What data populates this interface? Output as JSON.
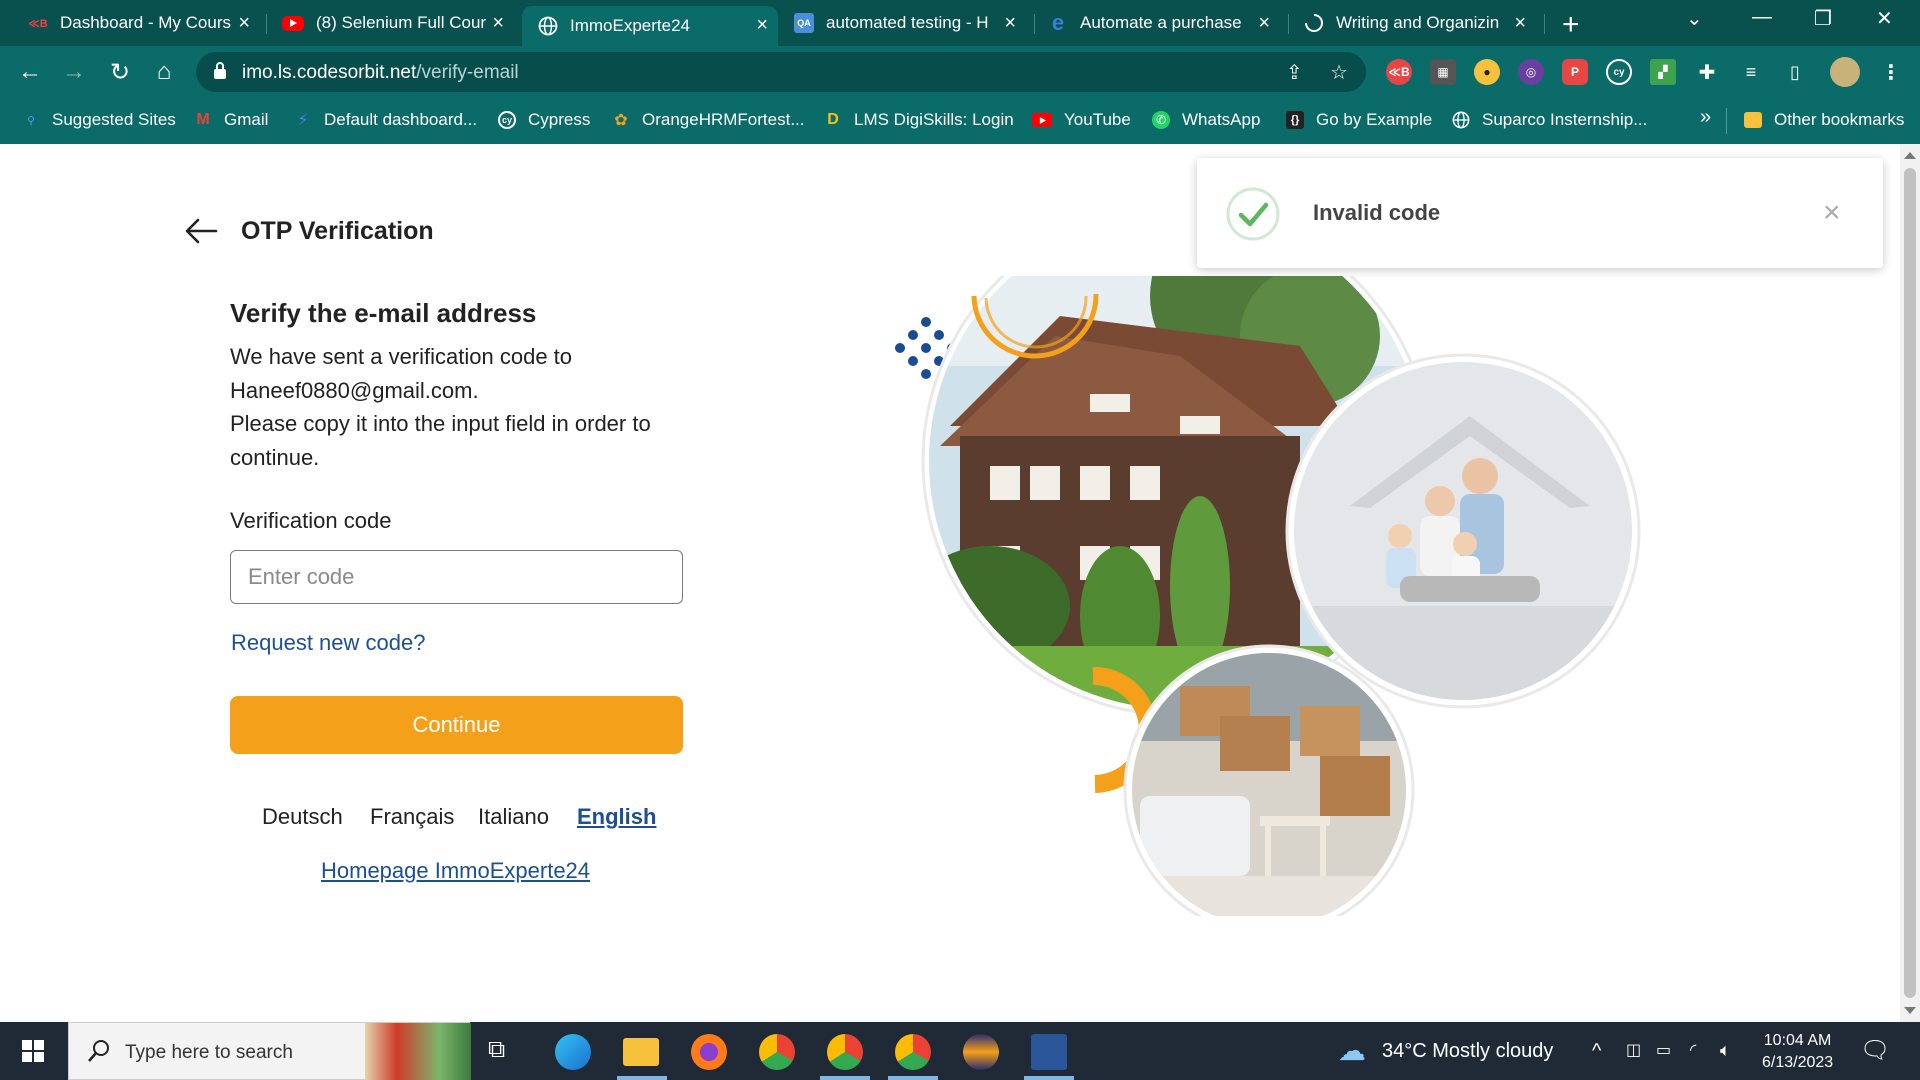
{
  "browser": {
    "tabs": [
      {
        "title": "Dashboard - My Cours",
        "favicon": "rb-icon",
        "active": false
      },
      {
        "title": "(8) Selenium Full Cour",
        "favicon": "youtube-icon",
        "active": false
      },
      {
        "title": "ImmoExperte24",
        "favicon": "globe-icon",
        "active": true
      },
      {
        "title": "automated testing - H",
        "favicon": "qa-icon",
        "active": false
      },
      {
        "title": "Automate a purchase",
        "favicon": "e-icon",
        "active": false
      },
      {
        "title": "Writing and Organizin",
        "favicon": "loading-icon",
        "active": false
      }
    ],
    "url_host": "imo.ls.codesorbit.net",
    "url_path": "/verify-email",
    "bookmarks": [
      {
        "label": "Suggested Sites"
      },
      {
        "label": "Gmail"
      },
      {
        "label": "Default dashboard..."
      },
      {
        "label": "Cypress"
      },
      {
        "label": "OrangeHRMFortest..."
      },
      {
        "label": "LMS DigiSkills: Login"
      },
      {
        "label": "YouTube"
      },
      {
        "label": "WhatsApp"
      },
      {
        "label": "Go by Example"
      },
      {
        "label": "Suparco Insternship..."
      }
    ],
    "bookmarks_more": "»",
    "other_bookmarks": "Other bookmarks"
  },
  "page": {
    "title": "OTP Verification",
    "heading": "Verify the e-mail address",
    "desc_line1": "We have sent a verification code to",
    "desc_email": "Haneef0880@gmail.com.",
    "desc_line3": "Please copy it into the input field in order to continue.",
    "field_label": "Verification code",
    "input_placeholder": "Enter code",
    "input_value": "",
    "request_link": "Request new code?",
    "continue_label": "Continue",
    "languages": [
      "Deutsch",
      "Français",
      "Italiano",
      "English"
    ],
    "active_language": "English",
    "homepage_link": "Homepage ImmoExperte24"
  },
  "toast": {
    "message": "Invalid code",
    "icon": "check-circle-icon",
    "close": "×"
  },
  "taskbar": {
    "search_placeholder": "Type here to search",
    "weather": "34°C  Mostly cloudy",
    "time": "10:04 AM",
    "date": "6/13/2023"
  },
  "colors": {
    "chrome": "#0a6b68",
    "accent_orange": "#f5a01a",
    "link_blue": "#1c4f94"
  }
}
